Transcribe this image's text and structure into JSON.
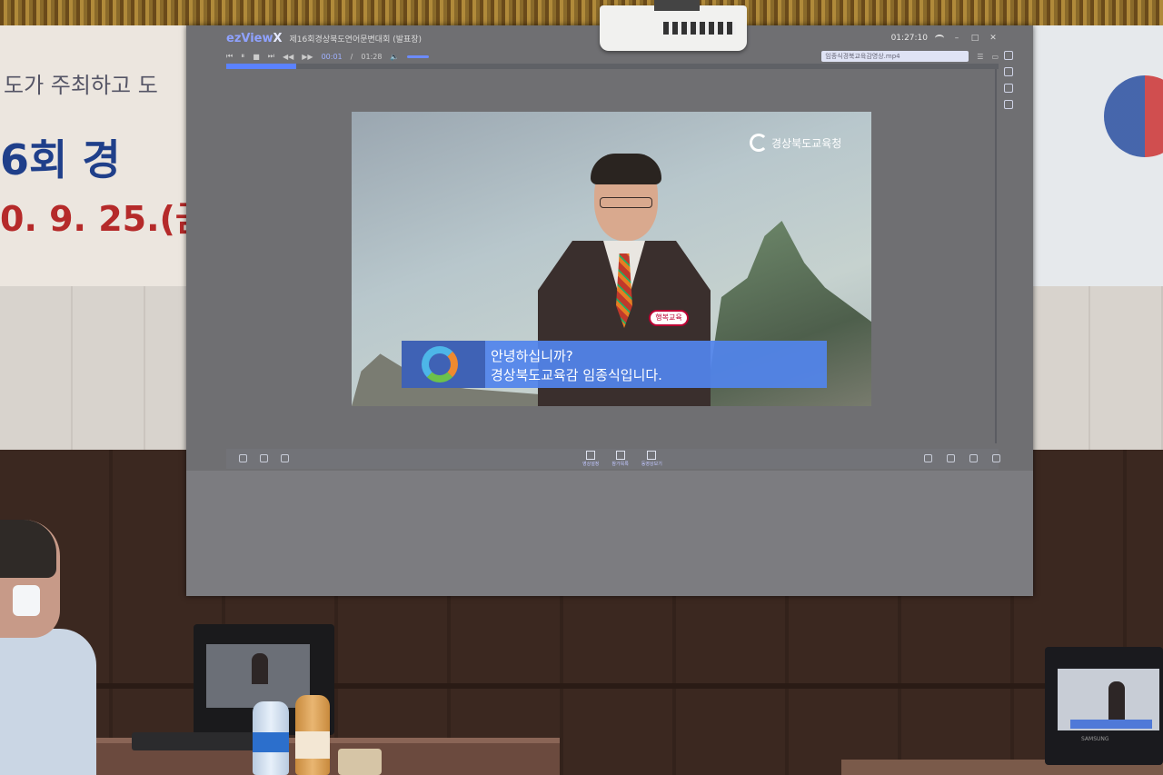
{
  "scene": {
    "banner_left": {
      "line1": "도가 주최하고 도",
      "line2": "6회 경",
      "line3": "0. 9. 25.(금"
    },
    "laptop_brand": "SAMSUNG"
  },
  "player": {
    "logo_prefix": "ezView",
    "logo_suffix": "X",
    "title": "제16회경상북도연어문변대회 (발표장)",
    "clock": "01:27:10",
    "time_current": "00:01",
    "time_total": "01:28",
    "file_name": "임종식경북교육감영상.mp4",
    "progress_fraction": 0.09,
    "window_buttons": [
      "–",
      "□",
      "✕"
    ],
    "bottom_tabs": [
      "영상설정",
      "참가목록",
      "동영상보기"
    ]
  },
  "video": {
    "logo_text": "경상북도교육청",
    "badge_text": "행복교육",
    "subtitle_line1": "안녕하십니까?",
    "subtitle_line2": "경상북도교육감 임종식입니다."
  }
}
